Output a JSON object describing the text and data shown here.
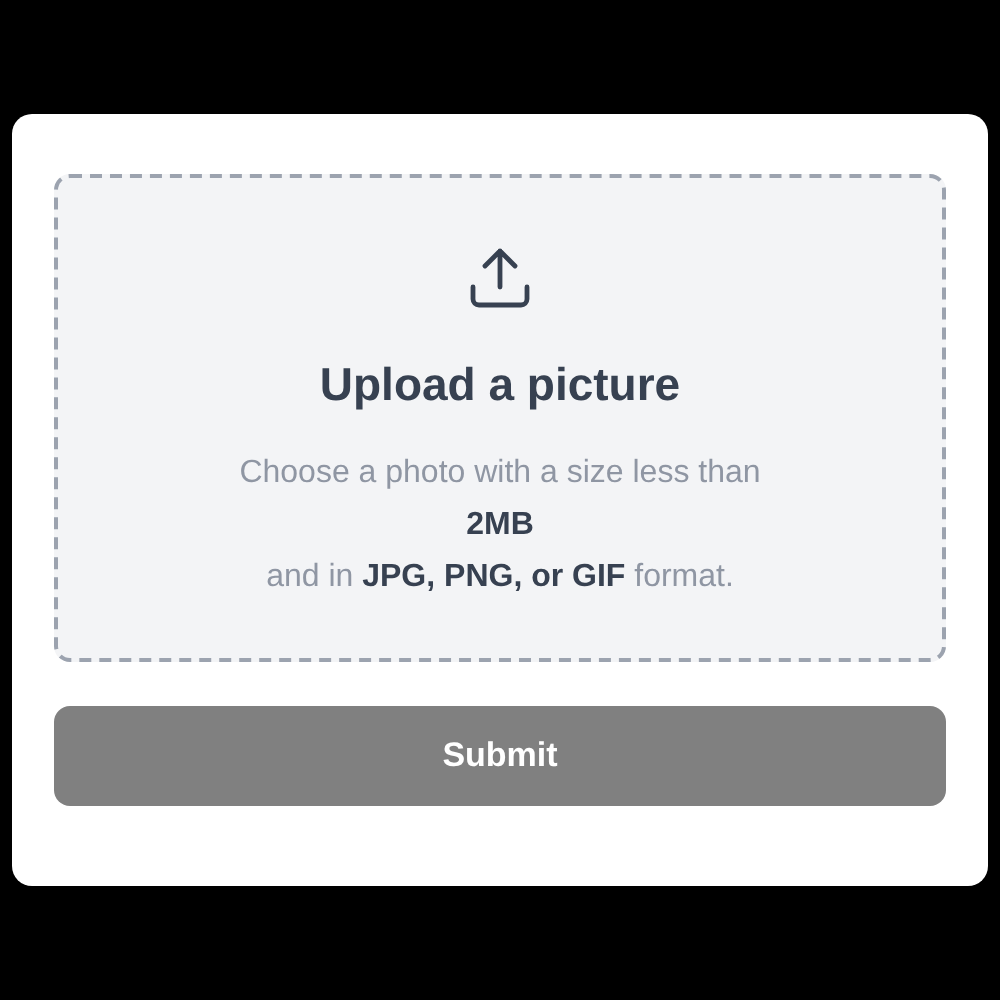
{
  "upload": {
    "title": "Upload a picture",
    "description_lines": [
      "Choose a photo with a size less than",
      "**2MB**",
      "and in **JPG, PNG, or GIF** format."
    ]
  },
  "submit": {
    "label": "Submit",
    "disabled": true
  }
}
